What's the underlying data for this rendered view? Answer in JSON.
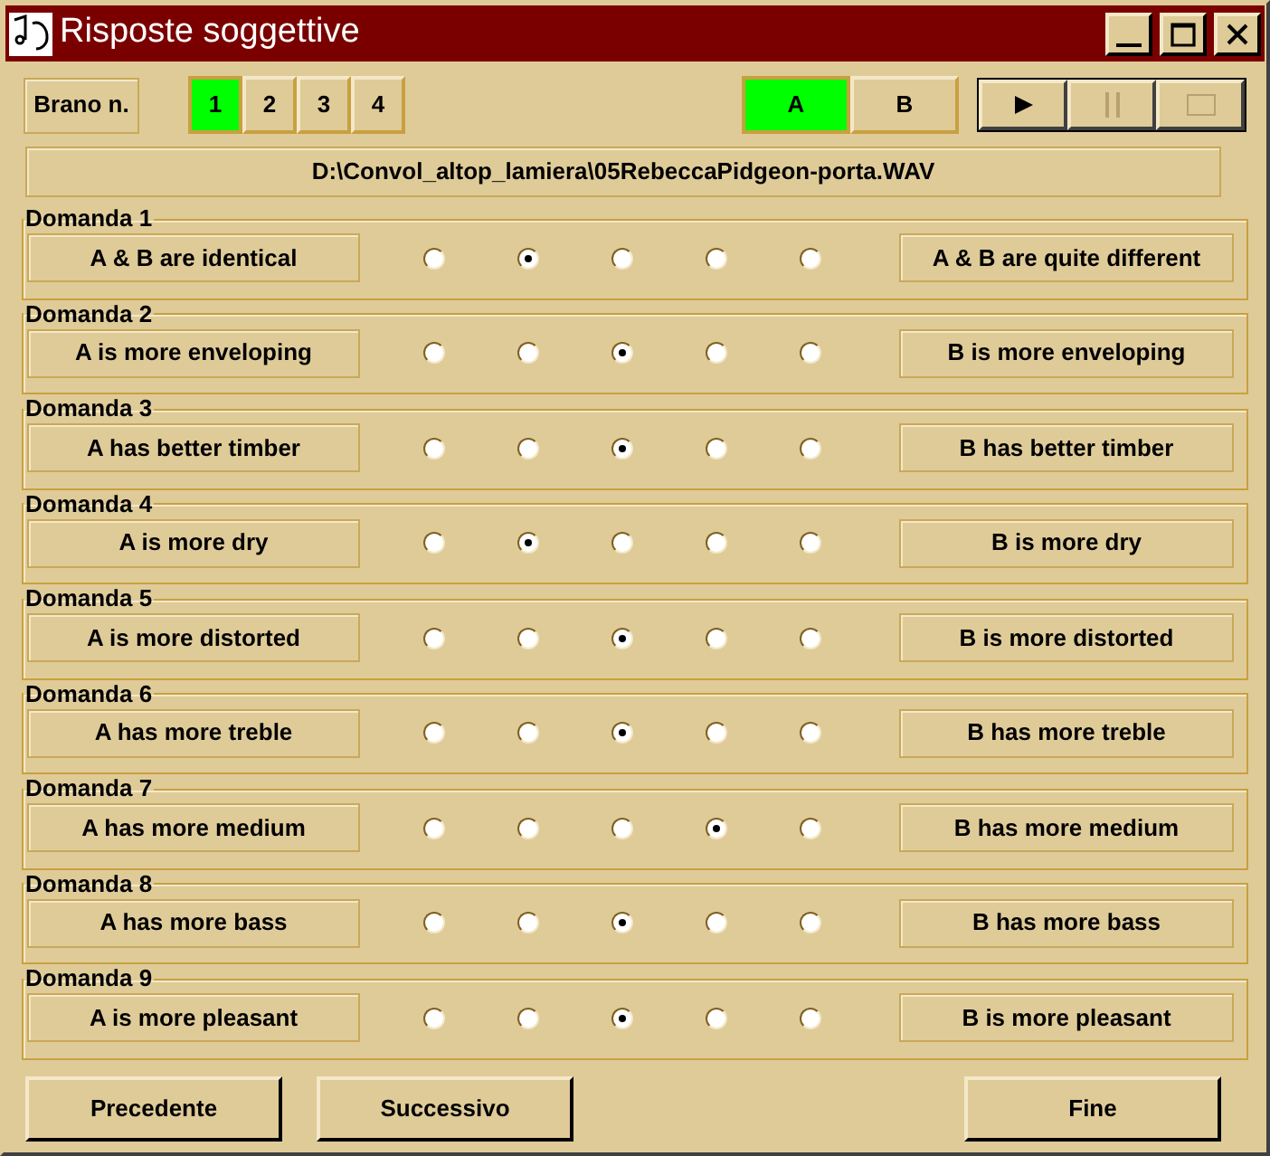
{
  "window": {
    "title": "Risposte soggettive"
  },
  "brano": {
    "label": "Brano n.",
    "tracks": [
      {
        "label": "1",
        "selected": true
      },
      {
        "label": "2",
        "selected": false
      },
      {
        "label": "3",
        "selected": false
      },
      {
        "label": "4",
        "selected": false
      }
    ]
  },
  "ab": [
    {
      "label": "A",
      "selected": true
    },
    {
      "label": "B",
      "selected": false
    }
  ],
  "transport": [
    {
      "kind": "play",
      "disabled": false
    },
    {
      "kind": "pause",
      "disabled": true
    },
    {
      "kind": "stop",
      "disabled": true
    }
  ],
  "file_path": "D:\\Convol_altop_lamiera\\05RebeccaPidgeon-porta.WAV",
  "questions": [
    {
      "title": "Domanda 1",
      "left": "A & B are identical",
      "right": "A & B are quite different",
      "options": [
        {
          "selected": false
        },
        {
          "selected": true
        },
        {
          "selected": false
        },
        {
          "selected": false
        },
        {
          "selected": false
        }
      ]
    },
    {
      "title": "Domanda 2",
      "left": "A is more enveloping",
      "right": "B is more enveloping",
      "options": [
        {
          "selected": false
        },
        {
          "selected": false
        },
        {
          "selected": true
        },
        {
          "selected": false
        },
        {
          "selected": false
        }
      ]
    },
    {
      "title": "Domanda 3",
      "left": "A has better timber",
      "right": "B has better timber",
      "options": [
        {
          "selected": false
        },
        {
          "selected": false
        },
        {
          "selected": true
        },
        {
          "selected": false
        },
        {
          "selected": false
        }
      ]
    },
    {
      "title": "Domanda 4",
      "left": "A is more dry",
      "right": "B is more dry",
      "options": [
        {
          "selected": false
        },
        {
          "selected": true
        },
        {
          "selected": false
        },
        {
          "selected": false
        },
        {
          "selected": false
        }
      ]
    },
    {
      "title": "Domanda 5",
      "left": "A is more distorted",
      "right": "B is more distorted",
      "options": [
        {
          "selected": false
        },
        {
          "selected": false
        },
        {
          "selected": true
        },
        {
          "selected": false
        },
        {
          "selected": false
        }
      ]
    },
    {
      "title": "Domanda 6",
      "left": "A has more treble",
      "right": "B has more treble",
      "options": [
        {
          "selected": false
        },
        {
          "selected": false
        },
        {
          "selected": true
        },
        {
          "selected": false
        },
        {
          "selected": false
        }
      ]
    },
    {
      "title": "Domanda 7",
      "left": "A has more medium",
      "right": "B has more medium",
      "options": [
        {
          "selected": false
        },
        {
          "selected": false
        },
        {
          "selected": false
        },
        {
          "selected": true
        },
        {
          "selected": false
        }
      ]
    },
    {
      "title": "Domanda 8",
      "left": "A has more bass",
      "right": "B has more bass",
      "options": [
        {
          "selected": false
        },
        {
          "selected": false
        },
        {
          "selected": true
        },
        {
          "selected": false
        },
        {
          "selected": false
        }
      ]
    },
    {
      "title": "Domanda 9",
      "left": "A is more pleasant",
      "right": "B is more pleasant",
      "options": [
        {
          "selected": false
        },
        {
          "selected": false
        },
        {
          "selected": true
        },
        {
          "selected": false
        },
        {
          "selected": false
        }
      ]
    }
  ],
  "buttons": [
    "Precedente",
    "Successivo",
    "Fine"
  ]
}
